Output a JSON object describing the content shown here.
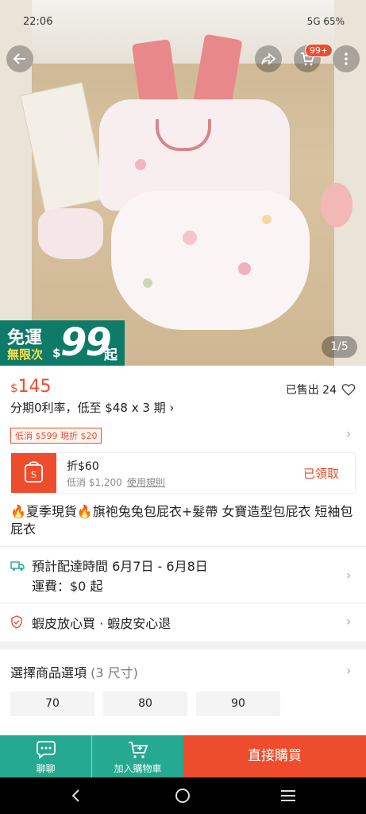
{
  "status_bar": {
    "time": "22:06",
    "system": "5G 65%"
  },
  "header": {
    "cart_badge": "99+"
  },
  "promo": {
    "line1": "免運",
    "line2": "無限次",
    "currency": "$",
    "amount": "99",
    "suffix": "起"
  },
  "gallery": {
    "pager": "1/5"
  },
  "price": {
    "currency": "$",
    "amount": "145"
  },
  "sold": {
    "label": "已售出 24"
  },
  "installment": "分期0利率，低至 $48 x 3 期 ›",
  "discount_chip": "低消 $599 現折 $20",
  "voucher": {
    "title": "折$60",
    "min_spend": "低消 $1,200",
    "rules_link": "使用規則",
    "status": "已領取"
  },
  "product_title": "🔥夏季現貨🔥旗袍兔兔包屁衣+髮帶 女寶造型包屁衣 短袖包屁衣",
  "shipping": {
    "line1": "預計配達時間 6月7日 - 6月8日",
    "line2": "運費：$0 起"
  },
  "guarantee": "蝦皮放心買 · 蝦皮安心退",
  "options": {
    "title": "選擇商品選項",
    "count": "(3 尺寸)",
    "sizes": [
      "70",
      "80",
      "90"
    ]
  },
  "bottom_bar": {
    "chat_label": "聊聊",
    "cart_label": "加入購物車",
    "buy_label": "直接購買"
  },
  "colors": {
    "brand": "#ee4d2d",
    "teal": "#25a990",
    "promo_green": "#0e7a68"
  }
}
